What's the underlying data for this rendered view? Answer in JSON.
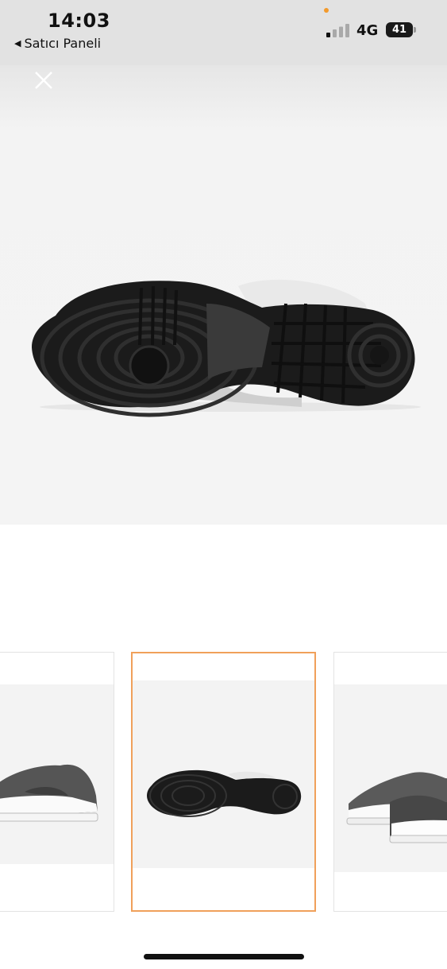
{
  "status_bar": {
    "time": "14:03",
    "back_label": "Satıcı Paneli",
    "network": "4G",
    "battery": "41",
    "signal_bars_active": 1
  },
  "viewer": {
    "close_icon": "close-icon",
    "main_image": "sneaker-outsole-image",
    "background_color": "#f4f4f4"
  },
  "thumbnails": [
    {
      "image": "sneaker-side-view",
      "selected": false
    },
    {
      "image": "sneaker-outsole",
      "selected": true
    },
    {
      "image": "sneaker-pair",
      "selected": false
    }
  ],
  "colors": {
    "accent": "#f0a05a",
    "status_dot": "#f39a2c"
  }
}
